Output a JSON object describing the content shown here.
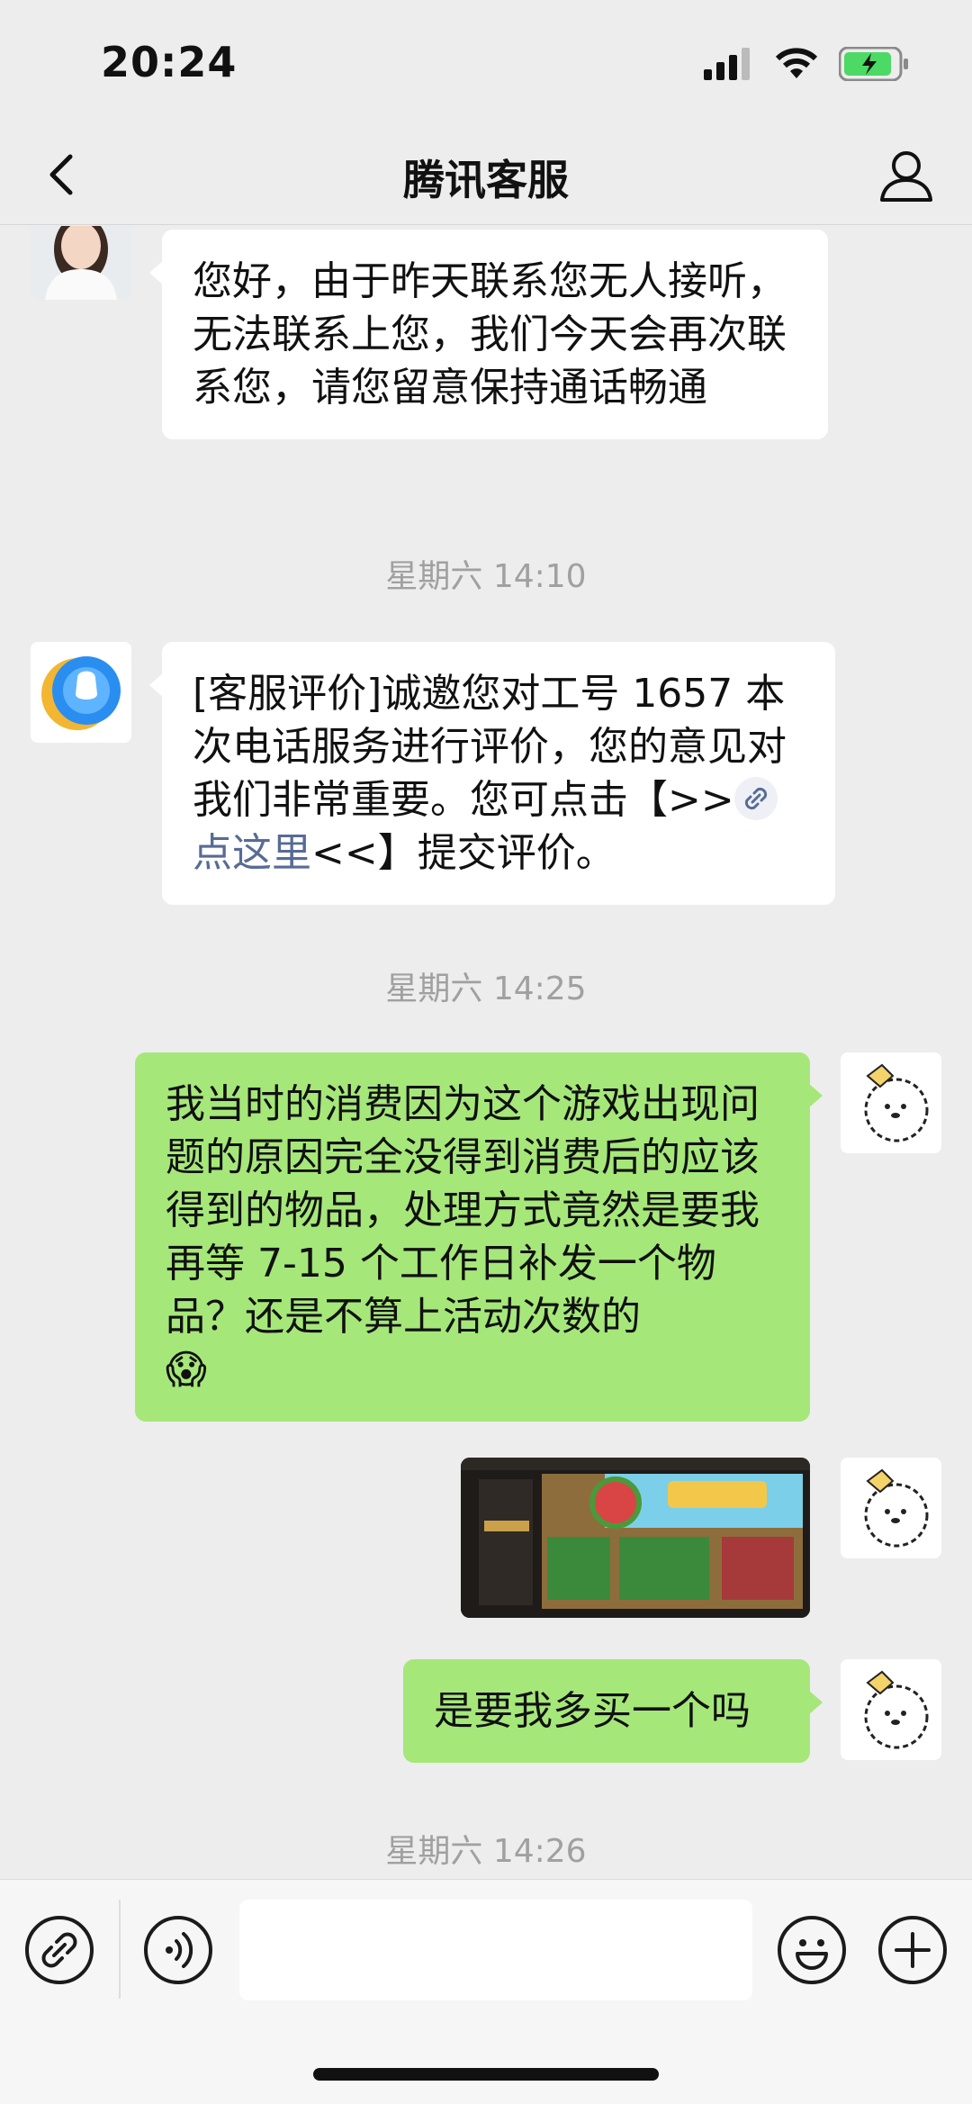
{
  "status": {
    "time": "20:24"
  },
  "nav": {
    "title": "腾讯客服"
  },
  "messages": [
    {
      "type": "in",
      "text": "您好，由于昨天联系您无人接听，无法联系上您，我们今天会再次联系您，请您留意保持通话畅通"
    },
    {
      "type": "time",
      "text": "星期六 14:10"
    },
    {
      "type": "in",
      "text_before": "[客服评价]诚邀您对工号 1657 本次电话服务进行评价，您的意见对我们非常重要。您可点击【>>",
      "link": "点这里",
      "text_after": "<<】提交评价。"
    },
    {
      "type": "time",
      "text": "星期六 14:25"
    },
    {
      "type": "out",
      "text": "我当时的消费因为这个游戏出现问题的原因完全没得到消费后的应该得到的物品，处理方式竟然是要我再等 7-15 个工作日补发一个物品？还是不算上活动次数的",
      "emoji": "😱"
    },
    {
      "type": "out-image",
      "caption": "game screenshot"
    },
    {
      "type": "out",
      "text": "是要我多买一个吗"
    },
    {
      "type": "time",
      "text": "星期六 14:26"
    }
  ],
  "icons": {
    "back": "chevron-left-icon",
    "profile": "person-icon",
    "mini_program": "link-icon",
    "voice": "voice-icon",
    "emoji": "smiley-icon",
    "plus": "plus-icon"
  },
  "colors": {
    "outgoing_bubble": "#a6e77a",
    "link": "#576b95",
    "background": "#ededed"
  }
}
